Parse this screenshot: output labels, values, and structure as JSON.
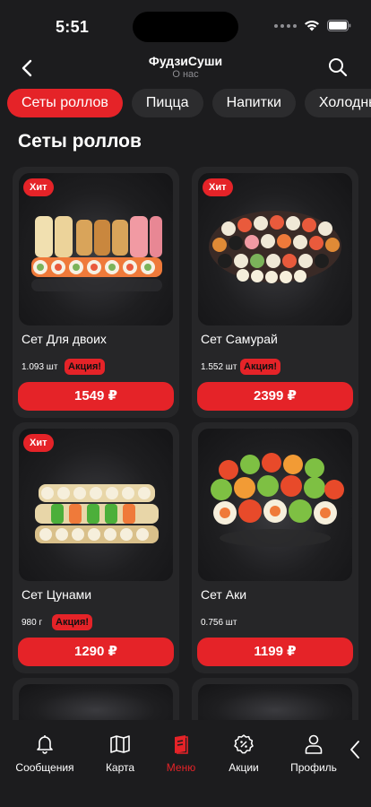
{
  "status_bar": {
    "time": "5:51"
  },
  "header": {
    "title": "ФудзиСуши",
    "subtitle": "О нас"
  },
  "tabs": [
    {
      "label": "Сеты роллов",
      "active": true
    },
    {
      "label": "Пицца",
      "active": false
    },
    {
      "label": "Напитки",
      "active": false
    },
    {
      "label": "Холодные",
      "active": false
    }
  ],
  "section_title": "Сеты роллов",
  "products": [
    {
      "name": "Сет Для двоих",
      "weight": "1.093 шт",
      "promo": "Акция!",
      "badge": "Хит",
      "price": "1549 ₽"
    },
    {
      "name": "Сет Самурай",
      "weight": "1.552 шт",
      "promo": "Акция!",
      "badge": "Хит",
      "price": "2399 ₽"
    },
    {
      "name": "Сет Цунами",
      "weight": "980 г",
      "promo": "Акция!",
      "badge": "Хит",
      "price": "1290 ₽"
    },
    {
      "name": "Сет Аки",
      "weight": "0.756 шт",
      "promo": "",
      "badge": "",
      "price": "1199 ₽"
    }
  ],
  "bottom_nav": [
    {
      "label": "Сообщения",
      "icon": "bell-icon",
      "active": false
    },
    {
      "label": "Карта",
      "icon": "map-icon",
      "active": false
    },
    {
      "label": "Меню",
      "icon": "menu-book-icon",
      "active": true
    },
    {
      "label": "Акции",
      "icon": "discount-icon",
      "active": false
    },
    {
      "label": "Профиль",
      "icon": "profile-icon",
      "active": false
    }
  ],
  "colors": {
    "accent": "#e52328",
    "background": "#1c1c1e",
    "card": "#262628"
  }
}
